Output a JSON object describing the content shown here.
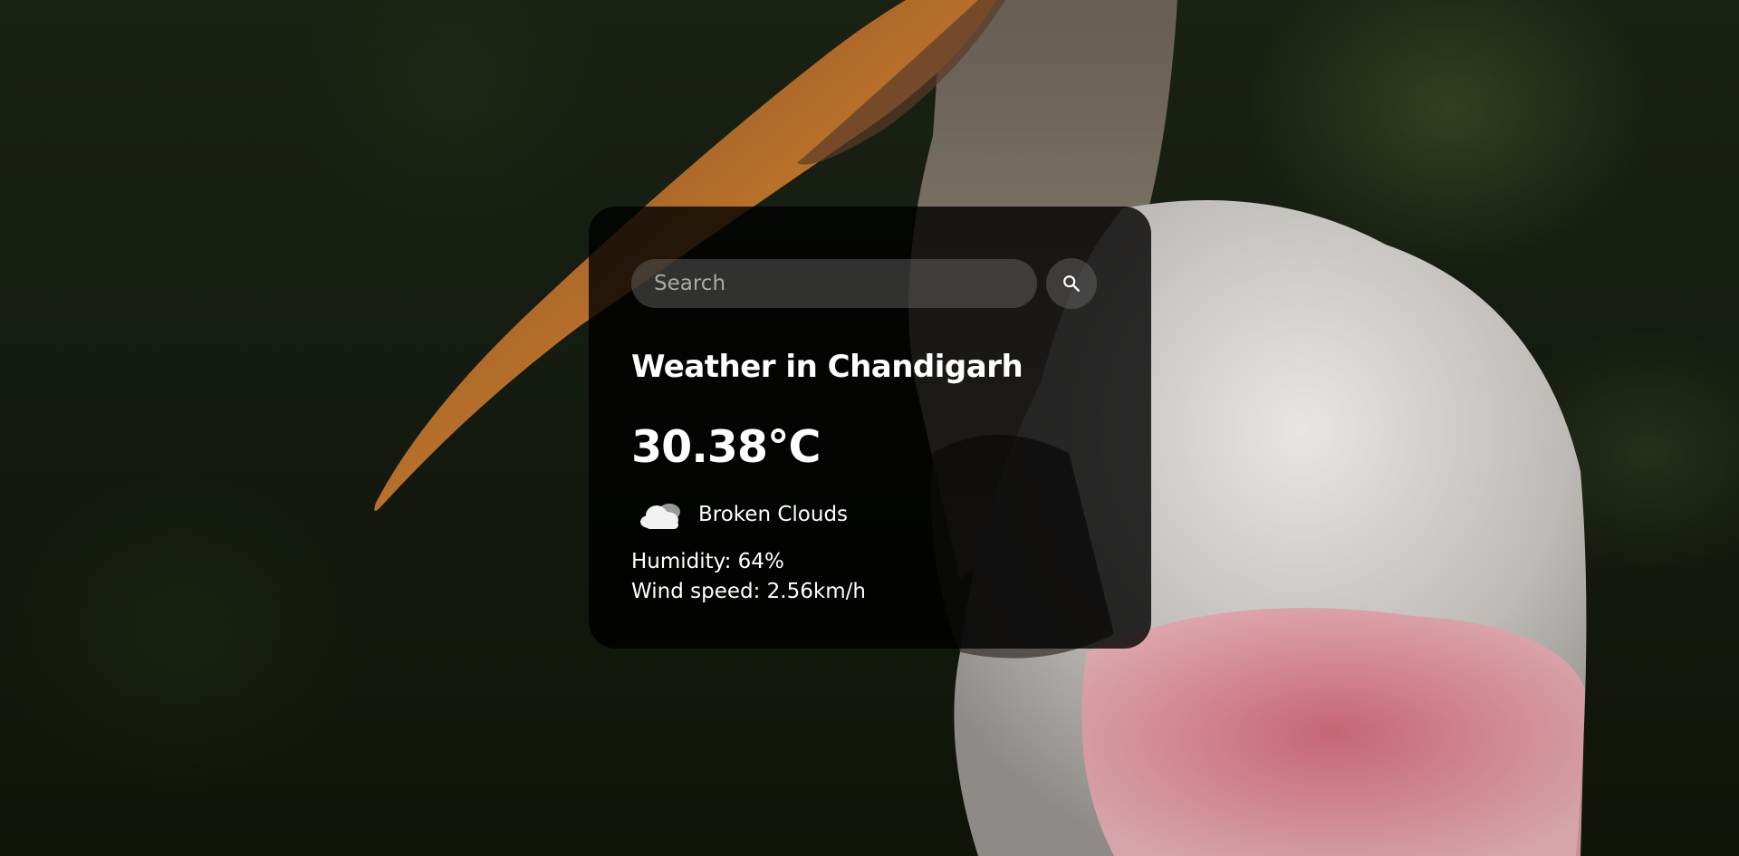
{
  "search": {
    "placeholder": "Search"
  },
  "weather": {
    "city_title": "Weather in Chandigarh",
    "temperature": "30.38°C",
    "description": "Broken Clouds",
    "humidity": "Humidity: 64%",
    "wind": "Wind speed: 2.56km/h"
  },
  "icons": {
    "search": "search-icon",
    "weather": "cloud-icon"
  },
  "colors": {
    "card_background": "#000000",
    "text": "#ffffff",
    "input_background": "#7c7c7c"
  }
}
